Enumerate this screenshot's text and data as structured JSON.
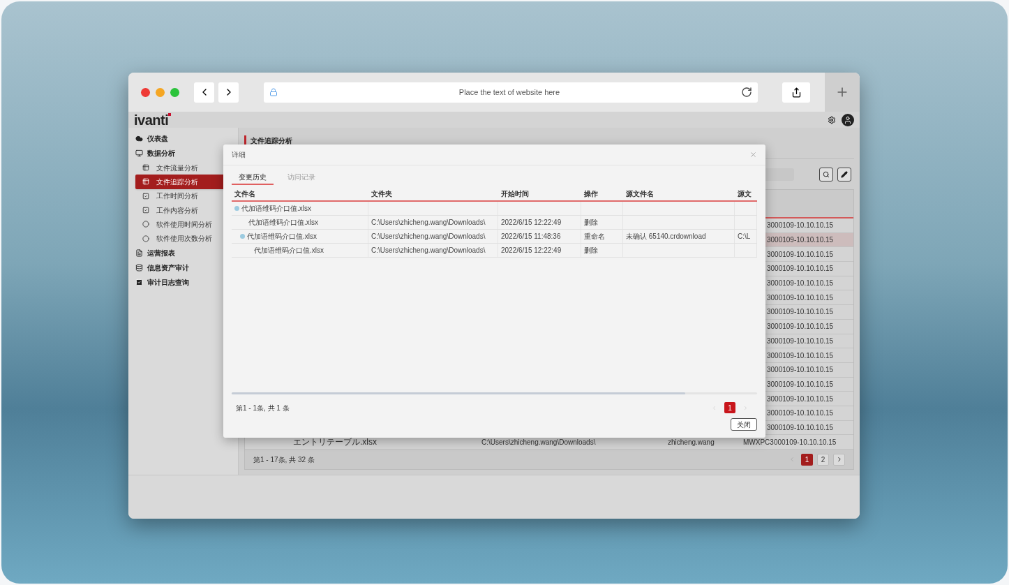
{
  "browser": {
    "url": "Place the text of website here"
  },
  "app": {
    "logo": "ivanti"
  },
  "sidebar": {
    "items": [
      {
        "label": "仪表盘",
        "selected": false
      },
      {
        "label": "数据分析",
        "selected": false,
        "children": [
          {
            "label": "文件流量分析",
            "selected": false
          },
          {
            "label": "文件追踪分析",
            "selected": true
          },
          {
            "label": "工作时间分析",
            "selected": false
          },
          {
            "label": "工作内容分析",
            "selected": false
          },
          {
            "label": "软件使用时间分析",
            "selected": false
          },
          {
            "label": "软件使用次数分析",
            "selected": false
          }
        ]
      },
      {
        "label": "运营报表",
        "selected": false
      },
      {
        "label": "信息资产审计",
        "selected": false
      },
      {
        "label": "审计日志查询",
        "selected": false
      }
    ]
  },
  "page": {
    "title": "文件追踪分析"
  },
  "background_table": {
    "rows": [
      {
        "selected": false,
        "column_5": "3000109-10.10.10.15"
      },
      {
        "selected": true,
        "column_5": "3000109-10.10.10.15"
      },
      {
        "selected": false,
        "column_5": "3000109-10.10.10.15"
      },
      {
        "selected": false,
        "column_5": "3000109-10.10.10.15"
      },
      {
        "selected": false,
        "column_5": "3000109-10.10.10.15"
      },
      {
        "selected": false,
        "column_5": "3000109-10.10.10.15"
      },
      {
        "selected": false,
        "column_5": "3000109-10.10.10.15"
      },
      {
        "selected": false,
        "column_5": "3000109-10.10.10.15"
      },
      {
        "selected": false,
        "column_5": "3000109-10.10.10.15"
      },
      {
        "selected": false,
        "column_5": "3000109-10.10.10.15"
      },
      {
        "selected": false,
        "column_5": "3000109-10.10.10.15"
      },
      {
        "selected": false,
        "column_5": "3000109-10.10.10.15"
      },
      {
        "selected": false,
        "column_5": "3000109-10.10.10.15"
      },
      {
        "selected": false,
        "column_5": "3000109-10.10.10.15"
      },
      {
        "selected": false,
        "column_5": "3000109-10.10.10.15"
      },
      {
        "selected": false,
        "column_2": "エントリテーブル.xlsx",
        "column_3": "C:\\Users\\zhicheng.wang\\Downloads\\",
        "column_4": "zhicheng.wang",
        "column_5": "MWXPC3000109-10.10.10.15"
      }
    ],
    "summary": "第1 - 17条, 共 32 条",
    "pages": [
      {
        "label": "1",
        "selected": true
      },
      {
        "label": "2",
        "selected": false
      }
    ]
  },
  "dialog": {
    "title": "详细",
    "tabs": [
      {
        "label": "变更历史",
        "selected": true
      },
      {
        "label": "访问记录",
        "selected": false
      }
    ],
    "columns": [
      "文件名",
      "文件夹",
      "开始时间",
      "操作",
      "源文件名",
      "源文"
    ],
    "rows": [
      {
        "name": "代加语维码介口值.xlsx",
        "expanded": true,
        "children": [
          {
            "name": "代加语维码介口值.xlsx",
            "folder": "C:\\Users\\zhicheng.wang\\Downloads\\",
            "start_time": "2022/6/15 12:22:49",
            "action": "删除"
          },
          {
            "name": "代加语维码介口值.xlsx",
            "expanded": true,
            "folder": "C:\\Users\\zhicheng.wang\\Downloads\\",
            "start_time": "2022/6/15 11:48:36",
            "action": "重命名",
            "source_name": "未确认 65140.crdownload",
            "column_6": "C:\\L",
            "children": [
              {
                "name": "代加语维码介口值.xlsx",
                "folder": "C:\\Users\\zhicheng.wang\\Downloads\\",
                "start_time": "2022/6/15 12:22:49",
                "action": "删除"
              }
            ]
          }
        ]
      }
    ],
    "summary": "第1 - 1条, 共 1 条",
    "pages": [
      {
        "label": "1",
        "selected": true
      }
    ],
    "close_button": "关闭"
  }
}
